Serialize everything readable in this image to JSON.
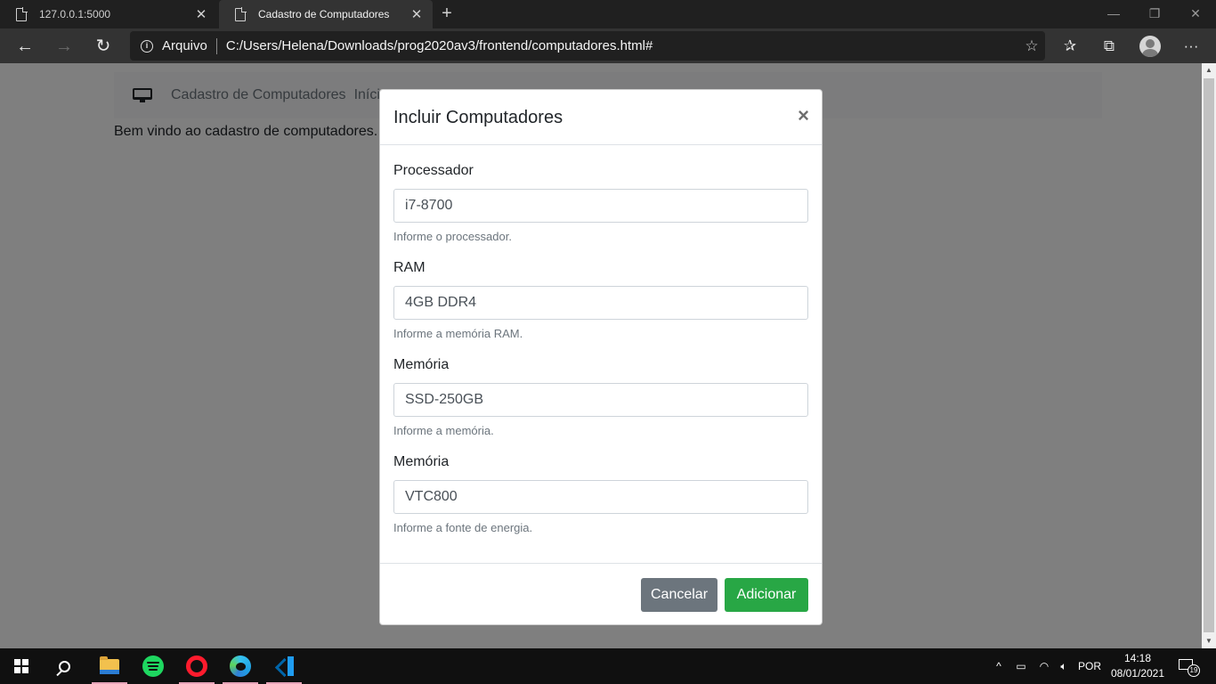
{
  "browser": {
    "tabs": [
      {
        "title": "127.0.0.1:5000"
      },
      {
        "title": "Cadastro de Computadores"
      }
    ],
    "address": {
      "security_label": "Arquivo",
      "url": "C:/Users/Helena/Downloads/prog2020av3/frontend/computadores.html#"
    }
  },
  "page": {
    "navbar": {
      "brand": "Cadastro de Computadores",
      "link": "Iníci"
    },
    "welcome": "Bem vindo ao cadastro de computadores."
  },
  "modal": {
    "title": "Incluir Computadores",
    "close_glyph": "×",
    "fields": [
      {
        "label": "Processador",
        "value": "i7-8700",
        "help": "Informe o processador."
      },
      {
        "label": "RAM",
        "value": "4GB DDR4",
        "help": "Informe a memória RAM."
      },
      {
        "label": "Memória",
        "value": "SSD-250GB",
        "help": "Informe a memória."
      },
      {
        "label": "Memória",
        "value": "VTC800",
        "help": "Informe a fonte de energia."
      }
    ],
    "buttons": {
      "cancel": "Cancelar",
      "add": "Adicionar"
    },
    "colors": {
      "cancel": "#6c757d",
      "add": "#28a745"
    }
  },
  "taskbar": {
    "tray": {
      "language": "POR",
      "time": "14:18",
      "date": "08/01/2021",
      "notifications": "19"
    }
  }
}
